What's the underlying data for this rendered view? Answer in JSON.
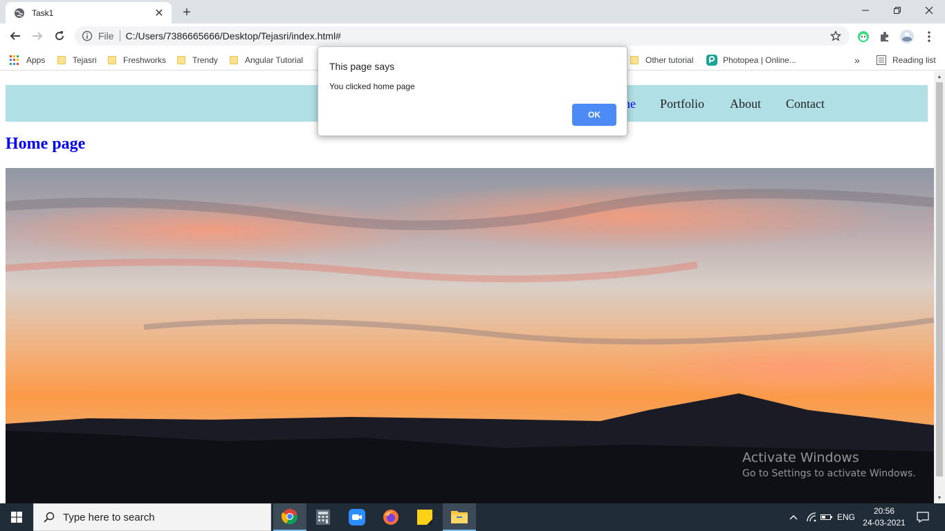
{
  "browser": {
    "tab": {
      "title": "Task1"
    },
    "address": {
      "scheme": "File",
      "url": "C:/Users/7386665666/Desktop/Tejasri/index.html#"
    },
    "bookmarks": [
      {
        "label": "Apps",
        "icon": "apps-grid-icon"
      },
      {
        "label": "Tejasri",
        "icon": "folder-icon"
      },
      {
        "label": "Freshworks",
        "icon": "folder-icon"
      },
      {
        "label": "Trendy",
        "icon": "folder-icon"
      },
      {
        "label": "Angular Tutorial",
        "icon": "folder-icon"
      },
      {
        "label": "Other tutorial",
        "icon": "folder-icon"
      },
      {
        "label": "Photopea | Online...",
        "icon": "photopea-icon"
      }
    ],
    "bookmarks_overflow": "»",
    "reading_list": "Reading list"
  },
  "page": {
    "nav": [
      {
        "label": "ne",
        "active": true
      },
      {
        "label": "Portfolio"
      },
      {
        "label": "About"
      },
      {
        "label": "Contact"
      }
    ],
    "heading": "Home page",
    "nav_bg": "#b0e0e6",
    "link_color": "#0000ee"
  },
  "dialog": {
    "title": "This page says",
    "message": "You clicked home page",
    "ok_label": "OK"
  },
  "watermark": {
    "line1": "Activate Windows",
    "line2": "Go to Settings to activate Windows."
  },
  "taskbar": {
    "search_placeholder": "Type here to search",
    "language": "ENG",
    "time": "20:56",
    "date": "24-03-2021"
  }
}
